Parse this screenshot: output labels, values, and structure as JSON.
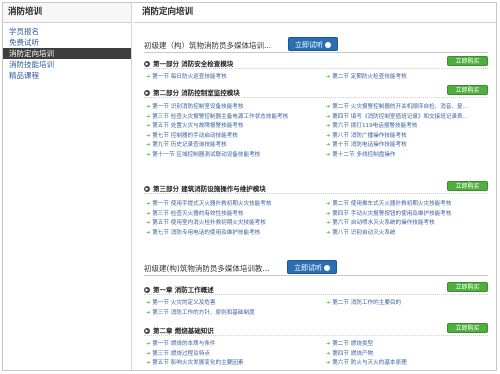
{
  "sidebar": {
    "title": "消防培训",
    "items": [
      {
        "label": "学员报名",
        "active": false
      },
      {
        "label": "免费试听",
        "active": false
      },
      {
        "label": "消防定向培训",
        "active": true
      },
      {
        "label": "消防技能培训",
        "active": false
      },
      {
        "label": "精品课程",
        "active": false
      }
    ]
  },
  "main": {
    "title": "消防定向培训",
    "trial_label": "立即试听",
    "buy_label": "立即购买",
    "courses": [
      {
        "title": "初级建（构）筑物消防员多媒体培训...",
        "sections": [
          {
            "title": "第一部分 消防安全检查模块",
            "lessons": [
              "第一节 每日防火巡查技能考核",
              "第二节 定期防火检查技能考核"
            ]
          },
          {
            "title": "第二部分 消防控制室监控模块",
            "lessons": [
              "第一节 识别消防控制室设备技能考核",
              "第二节 火灾报警控制器的开关机顺序自检、消音、复...",
              "第三节 检查火灾报警控制器主备电源工作状态技能考核",
              "第四节 填写《消防控制室值班记录》和交接班记录表...",
              "第五节 处置火灾与故障报警技能考核",
              "第六节 拨打119电话报警技能考核",
              "第七节 控制器的手动启动技能考核",
              "第八节 消防广播操作技能考核",
              "第九节 历史记录查询技能考核",
              "第十节 消防电话操作技能考核",
              "第十一节 区域控制器测试联动设备技能考核",
              "第十二节 多线控制盘操作"
            ]
          },
          {
            "title": "第三部分 建筑消防设施操作与维护模块",
            "lessons": [
              "第一节 使用手提式灭火器扑救初期火灾技能考核",
              "第二节 使用推车式灭火器扑救初期火灾技能考核",
              "第三节 检查灭火器的有效性技能考核",
              "第四节 手动火灾报警按钮的使用及维护技能考核",
              "第五节 使用室内消火栓扑救初期火灾技能考核",
              "第六节 自动喷水灭火系统的操作技能考核",
              "第七节 消防专用电话的使用及维护技能考核",
              "第八节 识别自动灭火系统"
            ]
          }
        ]
      },
      {
        "title": "初级建(构)筑物消防员多媒体培训教...",
        "sections": [
          {
            "title": "第一章 消防工作概述",
            "lessons": [
              "第一节 火灾的定义及危害",
              "第二节 消防工作的主要目的",
              "第三节 消防工作的方针、原则和基础制度"
            ]
          },
          {
            "title": "第二章 燃烧基础知识",
            "lessons": [
              "第一节 燃烧的本质与条件",
              "第二节 燃烧类型",
              "第三节 燃烧过程及特点",
              "第四节 燃烧产物",
              "第五节 影响火灾发展变化的主要因素",
              "第六节 防火与灭火的基本原理"
            ]
          }
        ]
      }
    ]
  }
}
